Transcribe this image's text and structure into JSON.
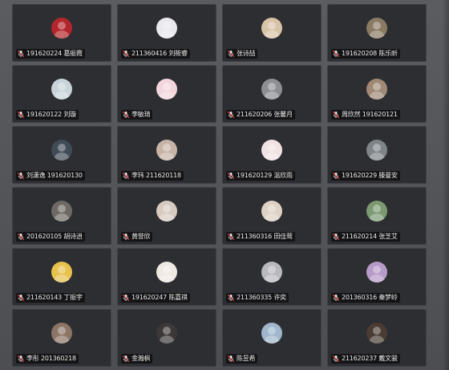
{
  "participants": [
    {
      "name": "191620224 葛振霞",
      "avatar_icon": "profile-photo-icon",
      "avatar_color": "#b3262c"
    },
    {
      "name": "211360416 刘筱睿",
      "avatar_icon": "profile-photo-icon",
      "avatar_color": "#e9e9ee"
    },
    {
      "name": "张诗喆",
      "avatar_icon": "profile-photo-icon",
      "avatar_color": "#d9c3a8"
    },
    {
      "name": "191620208 陈乐昕",
      "avatar_icon": "profile-photo-icon",
      "avatar_color": "#8a7a64"
    },
    {
      "name": "191620122 刘璇",
      "avatar_icon": "profile-photo-icon",
      "avatar_color": "#c9d4da"
    },
    {
      "name": "李敏琦",
      "avatar_icon": "profile-photo-icon",
      "avatar_color": "#f2d6dc"
    },
    {
      "name": "211620206 张馨月",
      "avatar_icon": "profile-photo-icon",
      "avatar_color": "#8e8f92"
    },
    {
      "name": "周欣然 191620121",
      "avatar_icon": "profile-photo-icon",
      "avatar_color": "#a08a76"
    },
    {
      "name": "刘潇逸 191620130",
      "avatar_icon": "profile-photo-icon",
      "avatar_color": "#3f4b57"
    },
    {
      "name": "李玮 211620118",
      "avatar_icon": "profile-photo-icon",
      "avatar_color": "#c7b4a7"
    },
    {
      "name": "191620129 温欣雨",
      "avatar_icon": "profile-photo-icon",
      "avatar_color": "#f1e2e4"
    },
    {
      "name": "191620229 滕曼安",
      "avatar_icon": "profile-photo-icon",
      "avatar_color": "#7f8489"
    },
    {
      "name": "201620105 胡诗逍",
      "avatar_icon": "profile-photo-icon",
      "avatar_color": "#6e6a63"
    },
    {
      "name": "黄誉欣",
      "avatar_icon": "profile-photo-icon",
      "avatar_color": "#d7cbc0"
    },
    {
      "name": "211360316 田佳莺",
      "avatar_icon": "profile-photo-icon",
      "avatar_color": "#ddd2c4"
    },
    {
      "name": "211620214 张芝艾",
      "avatar_icon": "profile-photo-icon",
      "avatar_color": "#7b9a72"
    },
    {
      "name": "211620143 丁振宇",
      "avatar_icon": "profile-photo-icon",
      "avatar_color": "#e7c24d"
    },
    {
      "name": "191620247 陈嘉祺",
      "avatar_icon": "profile-photo-icon",
      "avatar_color": "#efe9e4"
    },
    {
      "name": "211360335 许奕",
      "avatar_icon": "profile-photo-icon",
      "avatar_color": "#b9b8bd"
    },
    {
      "name": "201360316 秦梦岭",
      "avatar_icon": "profile-photo-icon",
      "avatar_color": "#b79ac8"
    },
    {
      "name": "李彤 201360218",
      "avatar_icon": "profile-photo-icon",
      "avatar_color": "#8d7566"
    },
    {
      "name": "金瀚枫",
      "avatar_icon": "profile-photo-icon",
      "avatar_color": "#3d3838"
    },
    {
      "name": "陈昱希",
      "avatar_icon": "profile-photo-icon",
      "avatar_color": "#9fb6cc"
    },
    {
      "name": "211620237 戴文骏",
      "avatar_icon": "profile-photo-icon",
      "avatar_color": "#4a3b33"
    }
  ],
  "mic_icon": "mic-muted-icon",
  "colors": {
    "tile_bg": "#2d2e32",
    "tile_border": "#3e4045",
    "page_bg": "#55575b",
    "label_text": "#e8e8e8",
    "mic_muted": "#e04848"
  }
}
